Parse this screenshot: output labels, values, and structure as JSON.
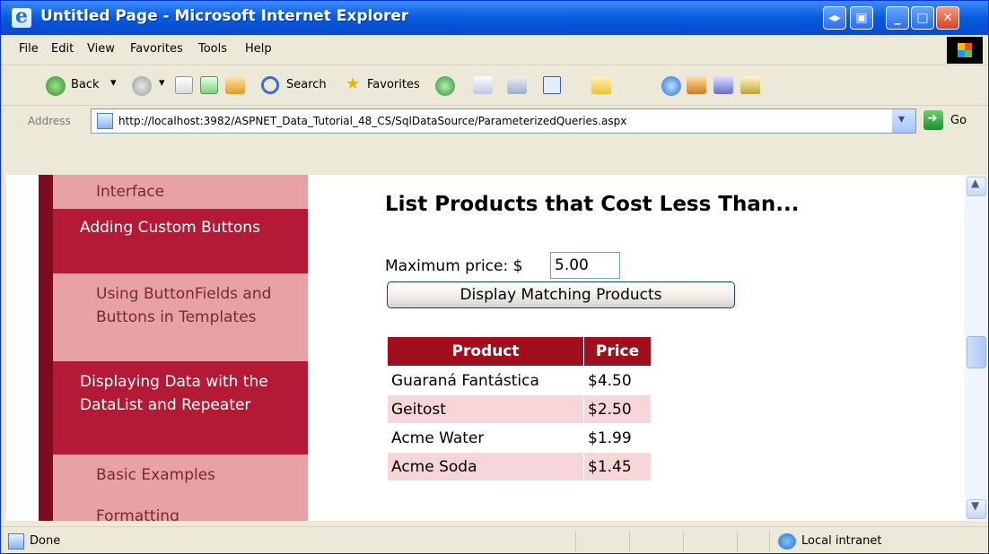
{
  "window": {
    "title": "Untitled Page - Microsoft Internet Explorer"
  },
  "menu": [
    "File",
    "Edit",
    "View",
    "Favorites",
    "Tools",
    "Help"
  ],
  "toolbar": {
    "back_label": "Back",
    "search_label": "Search",
    "favorites_label": "Favorites"
  },
  "address": {
    "label": "Address",
    "url": "http://localhost:3982/ASPNET_Data_Tutorial_48_CS/SqlDataSource/ParameterizedQueries.aspx",
    "go_label": "Go"
  },
  "sidebar": [
    {
      "label": "Interface",
      "type": "sub"
    },
    {
      "label": "Adding Custom Buttons",
      "type": "main"
    },
    {
      "label": "Using ButtonFields and Buttons in Templates",
      "type": "sub"
    },
    {
      "label": "Displaying Data with the DataList and Repeater",
      "type": "main"
    },
    {
      "label": "Basic Examples",
      "type": "sub"
    },
    {
      "label": "Formatting",
      "type": "sub"
    }
  ],
  "main": {
    "title": "List Products that Cost Less Than...",
    "price_label": "Maximum price: $",
    "price_value": "5.00",
    "button_label": "Display Matching Products"
  },
  "table": {
    "headers": [
      "Product",
      "Price"
    ],
    "rows": [
      [
        "Guaraná Fantástica",
        "$4.50"
      ],
      [
        "Geitost",
        "$2.50"
      ],
      [
        "Acme Water",
        "$1.99"
      ],
      [
        "Acme Soda",
        "$1.45"
      ]
    ]
  },
  "status": {
    "text": "Done",
    "zone": "Local intranet"
  }
}
